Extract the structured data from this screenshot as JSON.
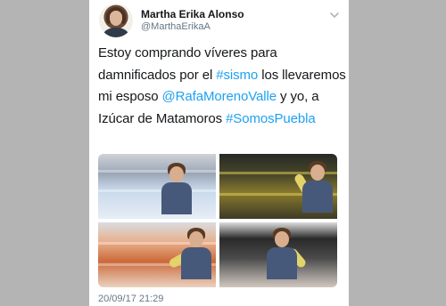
{
  "tweet": {
    "author_name": "Martha Erika Alonso",
    "author_handle": "@MarthaErikaA",
    "text_parts": {
      "p1": "Estoy comprando víveres para damnificados por el ",
      "hashtag_sismo": "#sismo",
      "p2": " los llevaremos mi esposo ",
      "mention": "@RafaMorenoValle",
      "p3": " y yo, a Izúcar de Matamoros ",
      "hashtag_somos": "#SomosPuebla"
    },
    "timestamp": "20/09/17 21:29",
    "link_color": "#1da1f2",
    "icons": [
      "avatar",
      "chevron-down-icon"
    ]
  }
}
